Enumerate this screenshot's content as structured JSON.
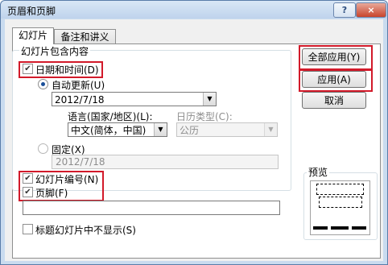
{
  "window": {
    "title": "页眉和页脚",
    "help_glyph": "?",
    "close_glyph": "×"
  },
  "tabs": [
    {
      "label": "幻灯片"
    },
    {
      "label": "备注和讲义"
    }
  ],
  "group": {
    "label": "幻灯片包含内容",
    "date_time": {
      "label": "日期和时间(D)",
      "checked": true
    },
    "auto_update": {
      "label": "自动更新(U)",
      "selected": true,
      "value": "2012/7/18"
    },
    "language": {
      "label": "语言(国家/地区)(L):",
      "value": "中文(简体，中国)"
    },
    "calendar": {
      "label": "日历类型(C):",
      "value": "公历"
    },
    "fixed": {
      "label": "固定(X)",
      "selected": false,
      "value": "2012/7/18"
    },
    "slide_number": {
      "label": "幻灯片编号(N)",
      "checked": true
    },
    "footer": {
      "label": "页脚(F)",
      "checked": true,
      "value": ""
    }
  },
  "hide_title": {
    "label": "标题幻灯片中不显示(S)",
    "checked": false
  },
  "buttons": {
    "apply_all": "全部应用(Y)",
    "apply": "应用(A)",
    "cancel": "取消"
  },
  "preview": {
    "label": "预览"
  },
  "icons": {
    "check": "✔",
    "dropdown": "▼"
  },
  "colors": {
    "highlight": "#d21a2a",
    "radio_dot": "#1b4f99"
  }
}
